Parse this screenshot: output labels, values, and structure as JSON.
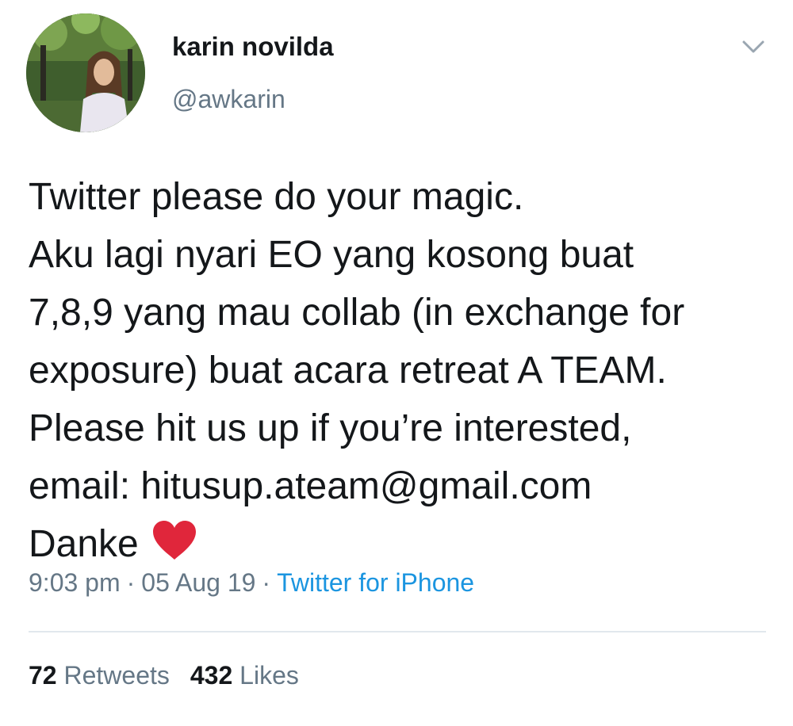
{
  "user": {
    "display_name": "karin novilda",
    "handle": "@awkarin"
  },
  "tweet": {
    "lines": [
      "Twitter please do your magic.",
      "Aku lagi nyari EO yang kosong buat",
      "7,8,9 yang mau collab (in exchange for",
      "exposure) buat acara retreat A TEAM.",
      "Please hit us up if you’re interested,",
      "email: hitusup.ateam@gmail.com",
      "Danke"
    ],
    "emoji": "heart-emoji"
  },
  "meta": {
    "time": "9:03 pm",
    "separator": "·",
    "date": "05 Aug 19",
    "source": "Twitter for iPhone"
  },
  "stats": {
    "retweets_count": "72",
    "retweets_label": "Retweets",
    "likes_count": "432",
    "likes_label": "Likes"
  },
  "icons": {
    "menu": "chevron-down-icon",
    "heart": "heart-emoji"
  },
  "colors": {
    "text": "#14171a",
    "secondary": "#657786",
    "link": "#1b95e0",
    "heart": "#e0263b",
    "divider": "#e1e8ed"
  }
}
